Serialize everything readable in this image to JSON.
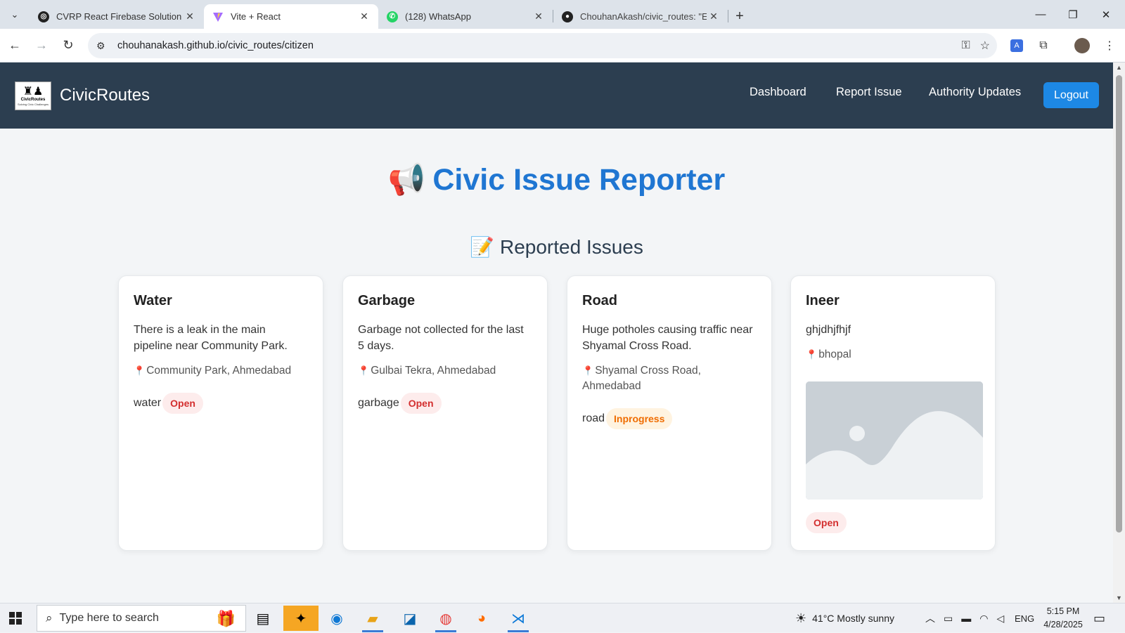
{
  "browser": {
    "tabs": [
      {
        "title": "CVRP React Firebase Solution",
        "active": false
      },
      {
        "title": "Vite + React",
        "active": true
      },
      {
        "title": "(128) WhatsApp",
        "active": false
      },
      {
        "title": "ChouhanAkash/civic_routes: \"Er",
        "active": false
      }
    ],
    "url": "chouhanakash.github.io/civic_routes/citizen"
  },
  "header": {
    "brand": "CivicRoutes",
    "logo_text": "CivicRoutes",
    "logo_subtext": "Solving Civic Challenges",
    "nav": [
      "Dashboard",
      "Report Issue",
      "Authority Updates"
    ],
    "logout_label": "Logout"
  },
  "page": {
    "title_icon": "📢",
    "title": "Civic Issue Reporter",
    "section_icon": "📝",
    "section_title": "Reported Issues"
  },
  "issues": [
    {
      "category": "Water",
      "description": "There is a leak in the main pipeline near Community Park.",
      "location": "Community Park, Ahmedabad",
      "image_alt": "water",
      "status": "Open"
    },
    {
      "category": "Garbage",
      "description": "Garbage not collected for the last 5 days.",
      "location": "Gulbai Tekra, Ahmedabad",
      "image_alt": "garbage",
      "status": "Open"
    },
    {
      "category": "Road",
      "description": "Huge potholes causing traffic near Shyamal Cross Road.",
      "location": "Shyamal Cross Road, Ahmedabad",
      "image_alt": "road",
      "status": "Inprogress"
    },
    {
      "category": "Ineer",
      "description": "ghjdhjfhjf",
      "location": "bhopal",
      "status": "Open"
    }
  ],
  "taskbar": {
    "search_placeholder": "Type here to search",
    "weather": "41°C  Mostly sunny",
    "language": "ENG",
    "time": "5:15 PM",
    "date": "4/28/2025"
  },
  "colors": {
    "header_bg": "#2c3e50",
    "accent": "#1f76d2",
    "logout_bg": "#1d88e5",
    "open_badge": "#d32f2f",
    "inprogress_badge": "#ef6c00"
  }
}
